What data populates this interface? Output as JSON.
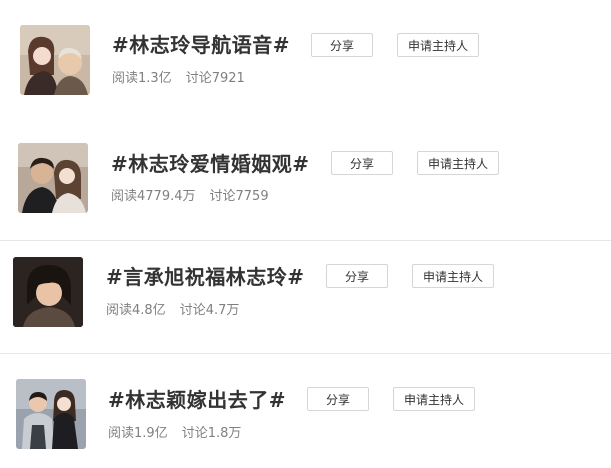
{
  "topics": [
    {
      "title": "#林志玲导航语音#",
      "share_label": "分享",
      "host_label": "申请主持人",
      "reads": "阅读1.3亿",
      "discussions": "讨论7921",
      "thumb_icon": "photo-two-people"
    },
    {
      "title": "#林志玲爱情婚姻观#",
      "share_label": "分享",
      "host_label": "申请主持人",
      "reads": "阅读4779.4万",
      "discussions": "讨论7759",
      "thumb_icon": "photo-couple"
    },
    {
      "title": "#言承旭祝福林志玲#",
      "share_label": "分享",
      "host_label": "申请主持人",
      "reads": "阅读4.8亿",
      "discussions": "讨论4.7万",
      "thumb_icon": "photo-man"
    },
    {
      "title": "#林志颖嫁出去了#",
      "share_label": "分享",
      "host_label": "申请主持人",
      "reads": "阅读1.9亿",
      "discussions": "讨论1.8万",
      "thumb_icon": "photo-two-people"
    }
  ]
}
